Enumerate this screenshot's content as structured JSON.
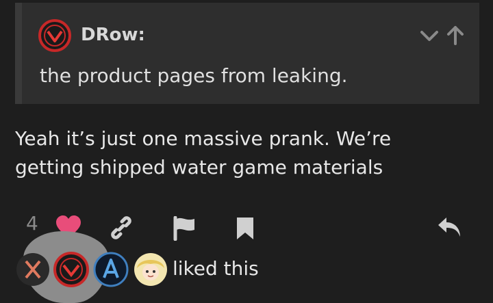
{
  "quote": {
    "author": "DRow:",
    "text": "the product pages from leaking."
  },
  "post": {
    "text": "Yeah it’s just one massive prank. We’re getting shipped water game materials"
  },
  "actions": {
    "like_count": "4",
    "icons": [
      "heart-icon",
      "link-icon",
      "flag-icon",
      "bookmark-icon",
      "reply-icon"
    ]
  },
  "likers": {
    "text": "liked this",
    "avatars": [
      "x-avatar",
      "red-emblem-avatar",
      "blue-a-avatar",
      "blonde-character-avatar"
    ]
  },
  "colors": {
    "background": "#1e1e1e",
    "quote_bg": "#2e2e2e",
    "heart": "#e84d7a",
    "icon_gray": "#d0d0d0"
  }
}
